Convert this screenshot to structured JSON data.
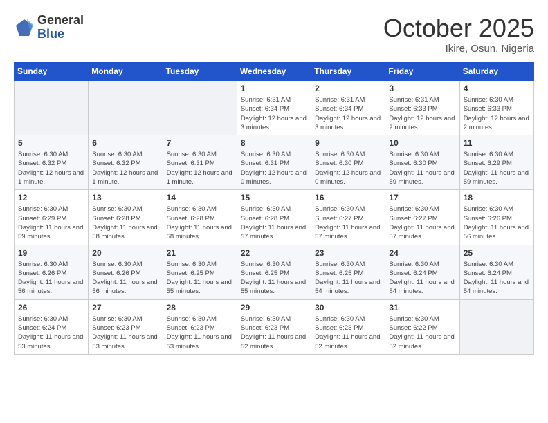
{
  "header": {
    "logo_line1": "General",
    "logo_line2": "Blue",
    "month_title": "October 2025",
    "location": "Ikire, Osun, Nigeria"
  },
  "days_of_week": [
    "Sunday",
    "Monday",
    "Tuesday",
    "Wednesday",
    "Thursday",
    "Friday",
    "Saturday"
  ],
  "weeks": [
    [
      {
        "day": "",
        "info": ""
      },
      {
        "day": "",
        "info": ""
      },
      {
        "day": "",
        "info": ""
      },
      {
        "day": "1",
        "info": "Sunrise: 6:31 AM\nSunset: 6:34 PM\nDaylight: 12 hours and 3 minutes."
      },
      {
        "day": "2",
        "info": "Sunrise: 6:31 AM\nSunset: 6:34 PM\nDaylight: 12 hours and 3 minutes."
      },
      {
        "day": "3",
        "info": "Sunrise: 6:31 AM\nSunset: 6:33 PM\nDaylight: 12 hours and 2 minutes."
      },
      {
        "day": "4",
        "info": "Sunrise: 6:30 AM\nSunset: 6:33 PM\nDaylight: 12 hours and 2 minutes."
      }
    ],
    [
      {
        "day": "5",
        "info": "Sunrise: 6:30 AM\nSunset: 6:32 PM\nDaylight: 12 hours and 1 minute."
      },
      {
        "day": "6",
        "info": "Sunrise: 6:30 AM\nSunset: 6:32 PM\nDaylight: 12 hours and 1 minute."
      },
      {
        "day": "7",
        "info": "Sunrise: 6:30 AM\nSunset: 6:31 PM\nDaylight: 12 hours and 1 minute."
      },
      {
        "day": "8",
        "info": "Sunrise: 6:30 AM\nSunset: 6:31 PM\nDaylight: 12 hours and 0 minutes."
      },
      {
        "day": "9",
        "info": "Sunrise: 6:30 AM\nSunset: 6:30 PM\nDaylight: 12 hours and 0 minutes."
      },
      {
        "day": "10",
        "info": "Sunrise: 6:30 AM\nSunset: 6:30 PM\nDaylight: 11 hours and 59 minutes."
      },
      {
        "day": "11",
        "info": "Sunrise: 6:30 AM\nSunset: 6:29 PM\nDaylight: 11 hours and 59 minutes."
      }
    ],
    [
      {
        "day": "12",
        "info": "Sunrise: 6:30 AM\nSunset: 6:29 PM\nDaylight: 11 hours and 59 minutes."
      },
      {
        "day": "13",
        "info": "Sunrise: 6:30 AM\nSunset: 6:28 PM\nDaylight: 11 hours and 58 minutes."
      },
      {
        "day": "14",
        "info": "Sunrise: 6:30 AM\nSunset: 6:28 PM\nDaylight: 11 hours and 58 minutes."
      },
      {
        "day": "15",
        "info": "Sunrise: 6:30 AM\nSunset: 6:28 PM\nDaylight: 11 hours and 57 minutes."
      },
      {
        "day": "16",
        "info": "Sunrise: 6:30 AM\nSunset: 6:27 PM\nDaylight: 11 hours and 57 minutes."
      },
      {
        "day": "17",
        "info": "Sunrise: 6:30 AM\nSunset: 6:27 PM\nDaylight: 11 hours and 57 minutes."
      },
      {
        "day": "18",
        "info": "Sunrise: 6:30 AM\nSunset: 6:26 PM\nDaylight: 11 hours and 56 minutes."
      }
    ],
    [
      {
        "day": "19",
        "info": "Sunrise: 6:30 AM\nSunset: 6:26 PM\nDaylight: 11 hours and 56 minutes."
      },
      {
        "day": "20",
        "info": "Sunrise: 6:30 AM\nSunset: 6:26 PM\nDaylight: 11 hours and 56 minutes."
      },
      {
        "day": "21",
        "info": "Sunrise: 6:30 AM\nSunset: 6:25 PM\nDaylight: 11 hours and 55 minutes."
      },
      {
        "day": "22",
        "info": "Sunrise: 6:30 AM\nSunset: 6:25 PM\nDaylight: 11 hours and 55 minutes."
      },
      {
        "day": "23",
        "info": "Sunrise: 6:30 AM\nSunset: 6:25 PM\nDaylight: 11 hours and 54 minutes."
      },
      {
        "day": "24",
        "info": "Sunrise: 6:30 AM\nSunset: 6:24 PM\nDaylight: 11 hours and 54 minutes."
      },
      {
        "day": "25",
        "info": "Sunrise: 6:30 AM\nSunset: 6:24 PM\nDaylight: 11 hours and 54 minutes."
      }
    ],
    [
      {
        "day": "26",
        "info": "Sunrise: 6:30 AM\nSunset: 6:24 PM\nDaylight: 11 hours and 53 minutes."
      },
      {
        "day": "27",
        "info": "Sunrise: 6:30 AM\nSunset: 6:23 PM\nDaylight: 11 hours and 53 minutes."
      },
      {
        "day": "28",
        "info": "Sunrise: 6:30 AM\nSunset: 6:23 PM\nDaylight: 11 hours and 53 minutes."
      },
      {
        "day": "29",
        "info": "Sunrise: 6:30 AM\nSunset: 6:23 PM\nDaylight: 11 hours and 52 minutes."
      },
      {
        "day": "30",
        "info": "Sunrise: 6:30 AM\nSunset: 6:23 PM\nDaylight: 11 hours and 52 minutes."
      },
      {
        "day": "31",
        "info": "Sunrise: 6:30 AM\nSunset: 6:22 PM\nDaylight: 11 hours and 52 minutes."
      },
      {
        "day": "",
        "info": ""
      }
    ]
  ]
}
